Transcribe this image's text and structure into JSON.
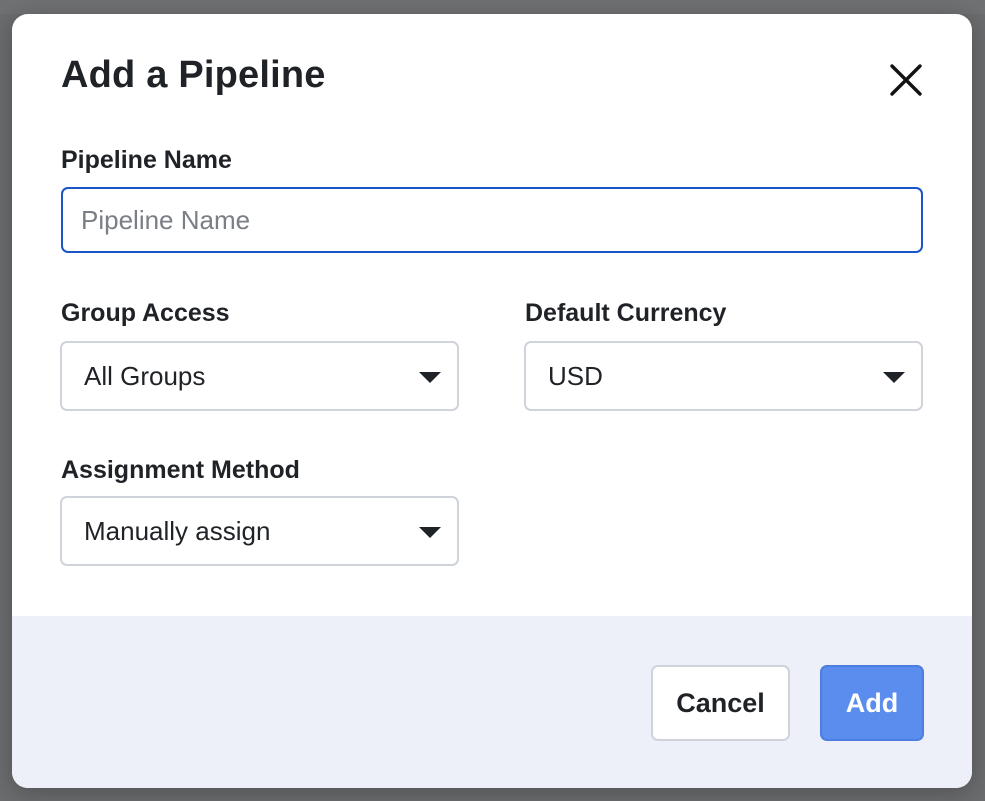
{
  "modal": {
    "title": "Add a Pipeline",
    "close_icon": "close-icon"
  },
  "fields": {
    "pipeline_name": {
      "label": "Pipeline Name",
      "placeholder": "Pipeline Name",
      "value": ""
    },
    "group_access": {
      "label": "Group Access",
      "selected": "All Groups"
    },
    "default_currency": {
      "label": "Default Currency",
      "selected": "USD"
    },
    "assignment_method": {
      "label": "Assignment Method",
      "selected": "Manually assign"
    }
  },
  "footer": {
    "cancel_label": "Cancel",
    "add_label": "Add"
  },
  "colors": {
    "accent": "#5b8def",
    "focus_border": "#1a56c9",
    "footer_bg": "#edf0f8",
    "text": "#1f2226"
  }
}
